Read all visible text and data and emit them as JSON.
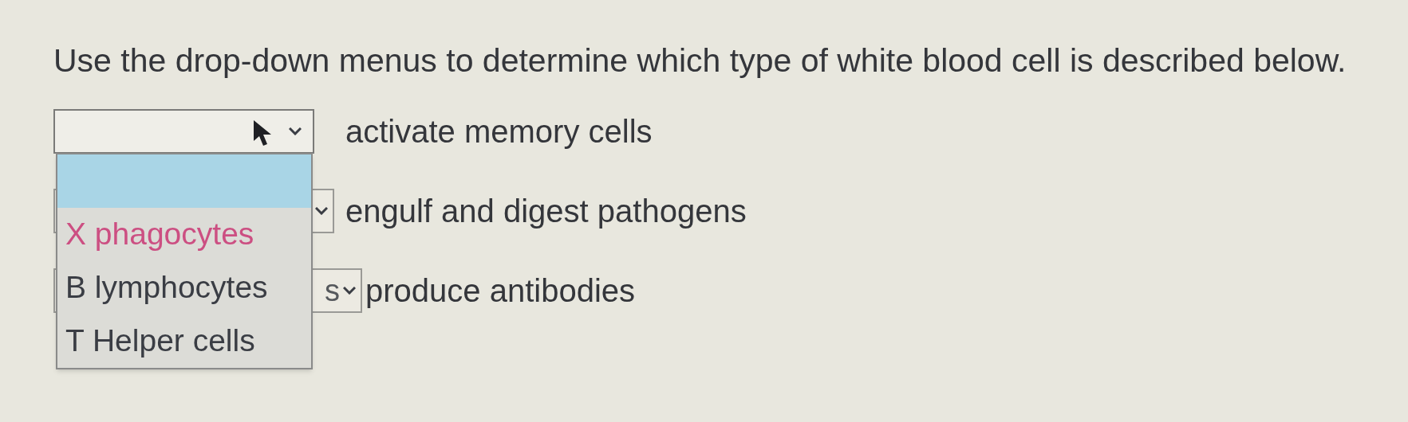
{
  "instruction": "Use the drop-down menus to determine which type of white blood cell is described below.",
  "rows": [
    {
      "select": {
        "open": true
      },
      "text": "activate memory cells"
    },
    {
      "select": {
        "open": false
      },
      "text": "engulf and digest pathogens"
    },
    {
      "select": {
        "open": false,
        "value": "s"
      },
      "text": "produce antibodies"
    }
  ],
  "dropdown": {
    "options": [
      {
        "selected": true
      },
      {
        "label": "X phagocytes",
        "selected": false,
        "color": "#cc4f82"
      },
      {
        "label": "B lymphocytes",
        "selected": false,
        "color": "#3a3d44"
      },
      {
        "label": "T Helper cells",
        "selected": false,
        "color": "#3a3d44"
      }
    ]
  }
}
